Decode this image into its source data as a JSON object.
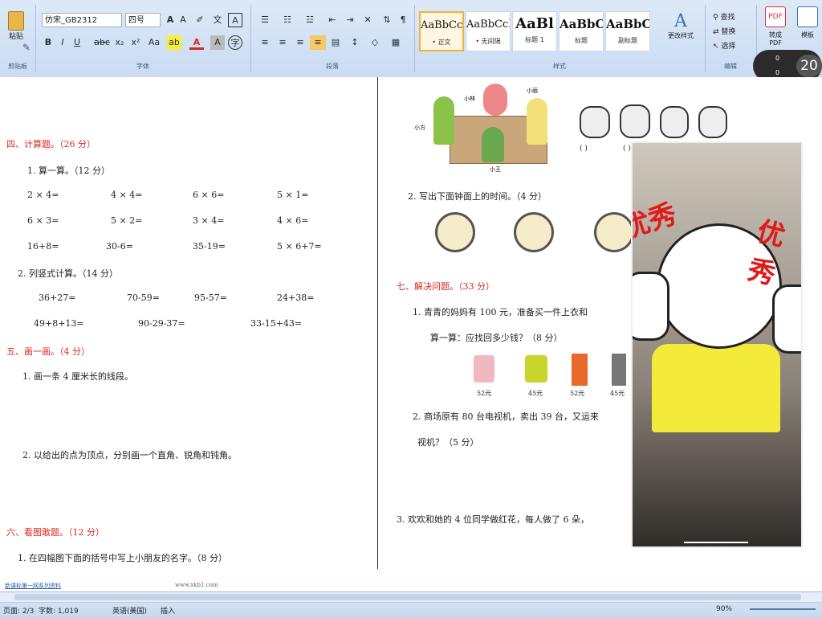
{
  "ribbon": {
    "paste_label": "粘贴",
    "clipboard_label": "剪贴板",
    "font_name": "仿宋_GB2312",
    "font_size": "四号",
    "font_group_label": "字体",
    "paragraph_group_label": "段落",
    "styles_group_label": "样式",
    "editing_group_label": "编辑",
    "styles": [
      {
        "preview": "AaBbCcI",
        "name": "• 正文"
      },
      {
        "preview": "AaBbCcI",
        "name": "• 无间隔"
      },
      {
        "preview": "AaBl",
        "name": "标题 1"
      },
      {
        "preview": "AaBbC",
        "name": "标题"
      },
      {
        "preview": "AaBbC",
        "name": "副标题"
      }
    ],
    "change_styles_label": "更改样式",
    "find_label": "查找",
    "replace_label": "替换",
    "select_label": "选择",
    "convert_pdf_label": "转成PDF",
    "template_label": "模板"
  },
  "timer": {
    "value": "20",
    "l1": "0",
    "l2": "0"
  },
  "doc": {
    "sec4": "四、计算题。（26 分）",
    "q1": "1. 算一算。（12 分）",
    "r1": [
      "2 × 4=",
      "4 × 4=",
      "6 × 6=",
      "5 × 1="
    ],
    "r2": [
      "6 × 3=",
      "5 × 2=",
      "3 × 4=",
      "4 × 6="
    ],
    "r3": [
      "16+8=",
      "30-6=",
      "35-19=",
      "5 × 6+7="
    ],
    "q2": "2. 列竖式计算。（14 分）",
    "r4": [
      "36+27=",
      "70-59=",
      "95-57=",
      "24+38="
    ],
    "r5": [
      "49+8+13=",
      "90-29-37=",
      "33-15+43="
    ],
    "sec5": "五、画一画。（4 分）",
    "d1": "1. 画一条 4 厘米长的线段。",
    "d2": "2. 以给出的点为顶点，分别画一个直角、锐角和钝角。",
    "sec6": "六、看图敢题。（12 分）",
    "p1": "1. 在四幅图下面的括号中写上小朋友的名字。（8 分）",
    "names": {
      "xiaolin": "小林",
      "xiaoli": "小丽",
      "xiaofang": "小方",
      "xiaowang": "小王"
    },
    "brackets": "(        )",
    "p2": "2. 写出下面钟面上的时间。（4 分）",
    "sec7": "七、解决问题。（33 分）",
    "s1": "1. 青青的妈妈有 100 元，准备买一件上衣和",
    "s1b": "算一算：应找回多少钱？（8 分）",
    "prices": [
      "52元",
      "45元",
      "52元",
      "45元"
    ],
    "s2": "2. 商场原有 80 台电视机，卖出 39 台，又运来",
    "s2b": "视机？（5 分）",
    "s3": "3. 欢欢和她的 4 位同学做红花，每人做了 6 朵，",
    "footer_left": "新课标第一网系列资料",
    "footer_mid": "www.xkb1.com"
  },
  "overlay": {
    "sticker_text_left": "优秀",
    "sticker_text_right": "优秀"
  },
  "statusbar": {
    "page": "页面: 2/3",
    "words": "字数: 1,019",
    "lang": "英语(美国)",
    "mode": "插入",
    "zoom": "90%"
  },
  "colors": {
    "accent_red": "#d9281c",
    "sticker_yellow": "#f4ea3a"
  }
}
